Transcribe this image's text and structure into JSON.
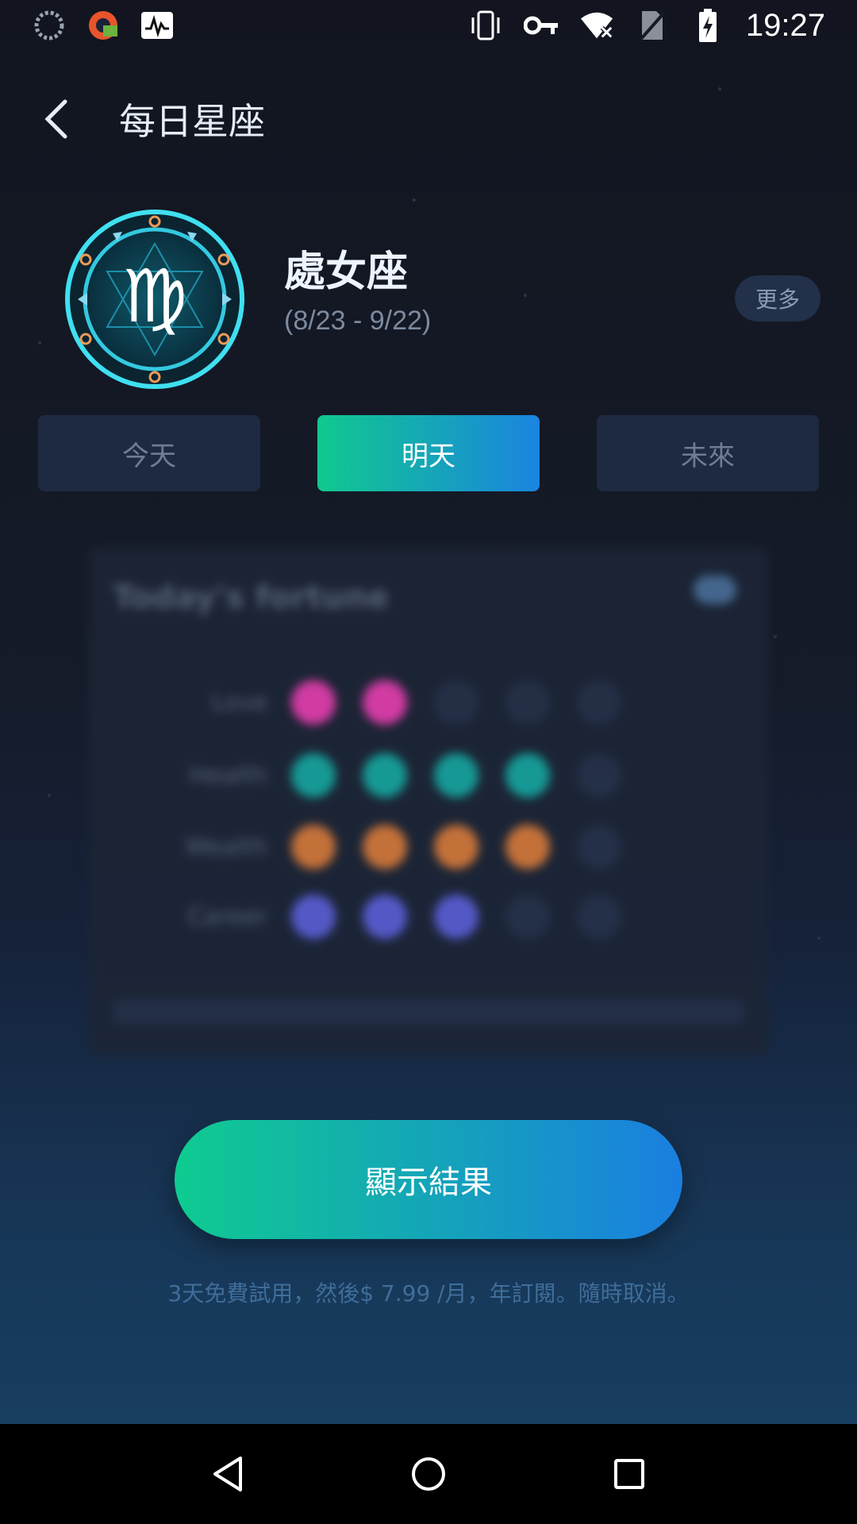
{
  "status_bar": {
    "time": "19:27"
  },
  "header": {
    "title": "每日星座"
  },
  "sign": {
    "name": "處女座",
    "dates": "(8/23 - 9/22)",
    "more_label": "更多"
  },
  "tabs": [
    {
      "label": "今天",
      "active": false
    },
    {
      "label": "明天",
      "active": true
    },
    {
      "label": "未來",
      "active": false
    }
  ],
  "fortune_card": {
    "title": "Today's fortune",
    "rows": [
      {
        "label": "Love",
        "filled": 2,
        "total": 5,
        "color": "#e63fb0"
      },
      {
        "label": "Health",
        "filled": 4,
        "total": 5,
        "color": "#17a7a0"
      },
      {
        "label": "Wealth",
        "filled": 4,
        "total": 5,
        "color": "#d77a3a"
      },
      {
        "label": "Career",
        "filled": 3,
        "total": 5,
        "color": "#5b5fd6"
      }
    ]
  },
  "action": {
    "show_result_label": "顯示結果",
    "trial_text": "3天免費試用，然後$ 7.99 /月，年訂閱。隨時取消。"
  },
  "colors": {
    "accent_start": "#10c98e",
    "accent_end": "#1b84e0"
  }
}
